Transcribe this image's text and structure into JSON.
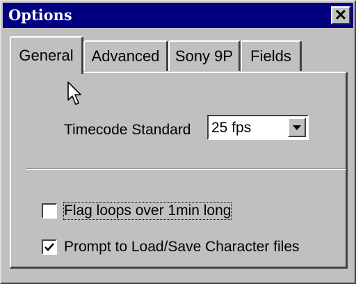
{
  "window": {
    "title": "Options",
    "close_icon": "close-icon"
  },
  "tabs": [
    {
      "label": "General",
      "active": true
    },
    {
      "label": "Advanced",
      "active": false
    },
    {
      "label": "Sony 9P",
      "active": false
    },
    {
      "label": "Fields",
      "active": false
    }
  ],
  "general": {
    "timecode_label": "Timecode Standard",
    "timecode_value": "25 fps",
    "checkboxes": [
      {
        "label": "Flag loops over 1min long",
        "checked": false
      },
      {
        "label": "Prompt to Load/Save Character files",
        "checked": true
      }
    ]
  },
  "colors": {
    "titlebar": "#000080",
    "face": "#c0c0c0"
  }
}
